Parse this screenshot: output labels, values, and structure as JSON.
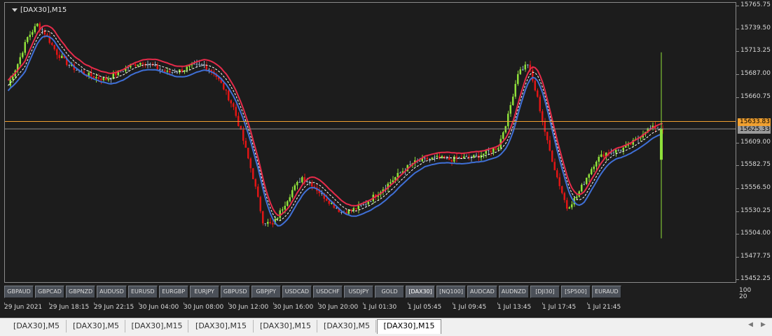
{
  "chart": {
    "title": "[DAX30],M15",
    "background": "#1c1c1c",
    "bull_color": "#8fe03a",
    "bear_color": "#e01515",
    "neutral_color": "#8ea6c4",
    "upper_band_color": "#e62b4a",
    "lower_band_color": "#3f6fd6",
    "middle_line_color": "#ffffff",
    "ask_line_color": "#f0a030",
    "bid_line_color": "#8a8a8a"
  },
  "price_axis": {
    "labels": [
      "15765.75",
      "15739.50",
      "15713.25",
      "15687.00",
      "15660.75",
      "15609.00",
      "15582.75",
      "15556.50",
      "15530.25",
      "15504.00",
      "15477.75",
      "15452.25"
    ],
    "ask_tag": "15633.83",
    "bid_tag": "15625.33"
  },
  "indicator_axis": {
    "top_label": "100",
    "bottom_label": "20"
  },
  "time_axis": {
    "labels": [
      "29 Jun 2021",
      "29 Jun 18:15",
      "29 Jun 22:15",
      "30 Jun 04:00",
      "30 Jun 08:00",
      "30 Jun 12:00",
      "30 Jun 16:00",
      "30 Jun 20:00",
      "1 Jul 01:30",
      "1 Jul 05:45",
      "1 Jul 09:45",
      "1 Jul 13:45",
      "1 Jul 17:45",
      "1 Jul 21:45"
    ]
  },
  "symbols": {
    "buttons": [
      "GBPAUD",
      "GBPCAD",
      "GBPNZD",
      "AUDUSD",
      "EURUSD",
      "EURGBP",
      "EURJPY",
      "GBPUSD",
      "GBPJPY",
      "USDCAD",
      "USDCHF",
      "USDJPY",
      "GOLD",
      "[DAX30]",
      "[NQ100]",
      "AUDCAD",
      "AUDNZD",
      "[DJI30]",
      "[SP500]",
      "EURAUD"
    ],
    "active": "[DAX30]"
  },
  "tabs": {
    "items": [
      "[DAX30],M5",
      "[DAX30],M5",
      "[DAX30],M15",
      "[DAX30],M15",
      "[DAX30],M15",
      "[DAX30],M5",
      "[DAX30],M15"
    ],
    "active_index": 6
  },
  "chart_data": {
    "type": "candlestick",
    "ylim": [
      15452.25,
      15765.75
    ],
    "ask": 15633.83,
    "bid": 15625.33,
    "price_path": [
      [
        0,
        15675
      ],
      [
        4,
        15700
      ],
      [
        8,
        15730
      ],
      [
        12,
        15745
      ],
      [
        15,
        15735
      ],
      [
        20,
        15712
      ],
      [
        25,
        15698
      ],
      [
        30,
        15690
      ],
      [
        35,
        15685
      ],
      [
        40,
        15682
      ],
      [
        45,
        15690
      ],
      [
        50,
        15698
      ],
      [
        55,
        15702
      ],
      [
        60,
        15696
      ],
      [
        65,
        15690
      ],
      [
        70,
        15692
      ],
      [
        75,
        15697
      ],
      [
        80,
        15698
      ],
      [
        84,
        15690
      ],
      [
        88,
        15672
      ],
      [
        92,
        15650
      ],
      [
        96,
        15612
      ],
      [
        100,
        15570
      ],
      [
        104,
        15520
      ],
      [
        108,
        15515
      ],
      [
        112,
        15535
      ],
      [
        116,
        15555
      ],
      [
        120,
        15570
      ],
      [
        124,
        15562
      ],
      [
        128,
        15550
      ],
      [
        132,
        15540
      ],
      [
        136,
        15530
      ],
      [
        140,
        15532
      ],
      [
        145,
        15538
      ],
      [
        150,
        15550
      ],
      [
        155,
        15562
      ],
      [
        160,
        15575
      ],
      [
        165,
        15586
      ],
      [
        170,
        15590
      ],
      [
        175,
        15592
      ],
      [
        180,
        15590
      ],
      [
        185,
        15592
      ],
      [
        190,
        15593
      ],
      [
        195,
        15598
      ],
      [
        200,
        15605
      ],
      [
        204,
        15640
      ],
      [
        208,
        15690
      ],
      [
        212,
        15700
      ],
      [
        216,
        15660
      ],
      [
        220,
        15610
      ],
      [
        224,
        15570
      ],
      [
        228,
        15535
      ],
      [
        232,
        15548
      ],
      [
        236,
        15570
      ],
      [
        240,
        15590
      ],
      [
        244,
        15598
      ],
      [
        248,
        15600
      ],
      [
        252,
        15604
      ],
      [
        256,
        15612
      ],
      [
        260,
        15624
      ],
      [
        264,
        15627
      ],
      [
        267,
        15626
      ]
    ],
    "last_bar": {
      "high": 15713,
      "low": 15500,
      "open": 15590,
      "close": 15625
    }
  }
}
